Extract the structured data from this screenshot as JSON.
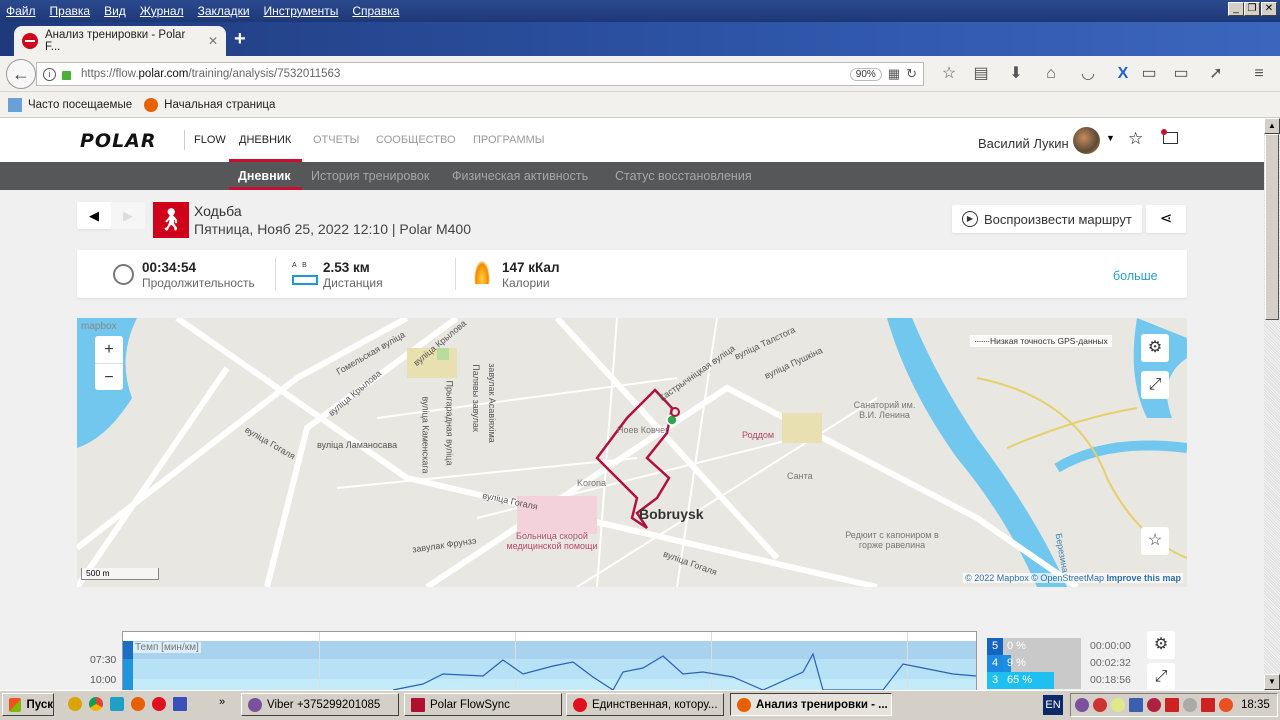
{
  "browser": {
    "menu": [
      "Файл",
      "Правка",
      "Вид",
      "Журнал",
      "Закладки",
      "Инструменты",
      "Справка"
    ],
    "tab_title": "Анализ тренировки - Polar F...",
    "url_prefix": "https://flow.",
    "url_domain": "polar.com",
    "url_path": "/training/analysis/7532011563",
    "zoom": "90%",
    "bookmarks": [
      "Часто посещаемые",
      "Начальная страница"
    ]
  },
  "header": {
    "logo": "POLAR",
    "flow": "FLOW",
    "nav": [
      "ДНЕВНИК",
      "ОТЧЕТЫ",
      "СООБЩЕСТВО",
      "ПРОГРАММЫ"
    ],
    "user": "Василий Лукин"
  },
  "subnav": [
    "Дневник",
    "История тренировок",
    "Физическая активность",
    "Статус восстановления"
  ],
  "training": {
    "sport": "Ходьба",
    "meta": "Пятница, Нояб 25, 2022 12:10 | Polar M400",
    "play_route": "Воспроизвести маршрут",
    "duration": "00:34:54",
    "duration_label": "Продолжительность",
    "distance": "2.53 км",
    "distance_label": "Дистанция",
    "ab": "A   B",
    "calories": "147 кКал",
    "calories_label": "Калории",
    "more": "больше"
  },
  "map": {
    "brand": "mapbox",
    "gps_legend": "Низкая точность GPS-данных",
    "scale": "500 m",
    "attribution": "© 2022 Mapbox © OpenStreetMap",
    "improve": "Improve this map",
    "labels": [
      "Гомельская вуліца",
      "вуліца Крылова",
      "вуліца Крылова",
      "вуліца Гогаля",
      "вуліца Ламаносава",
      "вуліца Каменскага",
      "Прыгарадная вуліца",
      "Палявы завулак",
      "завулак Асавіяхіма",
      "вуліца Гогаля",
      "завулак Фрунзэ",
      "Korona",
      "Ноев Ковчег",
      "Bobruysk",
      "Роддом",
      "Санта",
      "Санаторий им. В.И. Ленина",
      "Редюит с капониром в горже равелина",
      "вуліца Талстога",
      "вуліца Пушкіна",
      "Кастрычніцкая вуліца",
      "вуліца Гогаля",
      "Березина"
    ],
    "hospital": "Больница скорой медицинской помощи"
  },
  "chart": {
    "label": "Темп [мин/км]",
    "yticks": [
      "07:30",
      "10:00"
    ],
    "zones": [
      {
        "n": "5",
        "pct": "0 %",
        "time": "00:00:00",
        "fill": 0
      },
      {
        "n": "4",
        "pct": "9 %",
        "time": "00:02:32",
        "fill": 9
      },
      {
        "n": "3",
        "pct": "65 %",
        "time": "00:18:56",
        "fill": 65
      }
    ]
  },
  "taskbar": {
    "start": "Пуск",
    "tasks": [
      "Viber +375299201085",
      "Polar FlowSync",
      "Единственная, котору...",
      "Анализ тренировки - ..."
    ],
    "lang": "EN",
    "clock": "18:35"
  }
}
